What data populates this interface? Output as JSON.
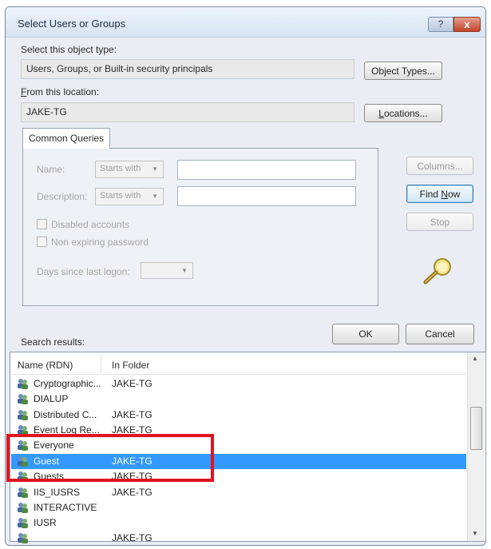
{
  "dialog": {
    "title": "Select Users or Groups",
    "help_label": "?",
    "close_label": "x"
  },
  "object_type": {
    "label": "Select this object type:",
    "value": "Users, Groups, or Built-in security principals",
    "button": "Object Types..."
  },
  "location": {
    "label_u": "F",
    "label_rest": "rom this location:",
    "value": "JAKE-TG",
    "button_u": "L",
    "button_rest": "ocations..."
  },
  "common_queries": {
    "tab": "Common Queries",
    "name_label": "Name:",
    "name_operator": "Starts with",
    "description_label": "Description:",
    "description_operator": "Starts with",
    "disabled_accounts": "Disabled accounts",
    "non_expiring": "Non expiring password",
    "days_label": "Days since last logon:"
  },
  "side_buttons": {
    "columns": "Columns...",
    "find_now_a": "Find ",
    "find_now_u": "N",
    "find_now_b": "ow",
    "stop": "Stop"
  },
  "actions": {
    "ok": "OK",
    "cancel": "Cancel"
  },
  "results": {
    "label": "Search results:",
    "columns": [
      "Name (RDN)",
      "In Folder"
    ],
    "rows": [
      {
        "name": "Cryptographic...",
        "folder": "JAKE-TG",
        "selected": false
      },
      {
        "name": "DIALUP",
        "folder": "",
        "selected": false
      },
      {
        "name": "Distributed C...",
        "folder": "JAKE-TG",
        "selected": false
      },
      {
        "name": "Event Log Re...",
        "folder": "JAKE-TG",
        "selected": false
      },
      {
        "name": "Everyone",
        "folder": "",
        "selected": false
      },
      {
        "name": "Guest",
        "folder": "JAKE-TG",
        "selected": true
      },
      {
        "name": "Guests",
        "folder": "JAKE-TG",
        "selected": false
      },
      {
        "name": "IIS_IUSRS",
        "folder": "JAKE-TG",
        "selected": false
      },
      {
        "name": "INTERACTIVE",
        "folder": "",
        "selected": false
      },
      {
        "name": "IUSR",
        "folder": "",
        "selected": false
      },
      {
        "name": "",
        "folder": "JAKE-TG",
        "selected": false
      }
    ]
  },
  "colors": {
    "selection": "#3399ff",
    "highlight_box": "#e0141e"
  }
}
